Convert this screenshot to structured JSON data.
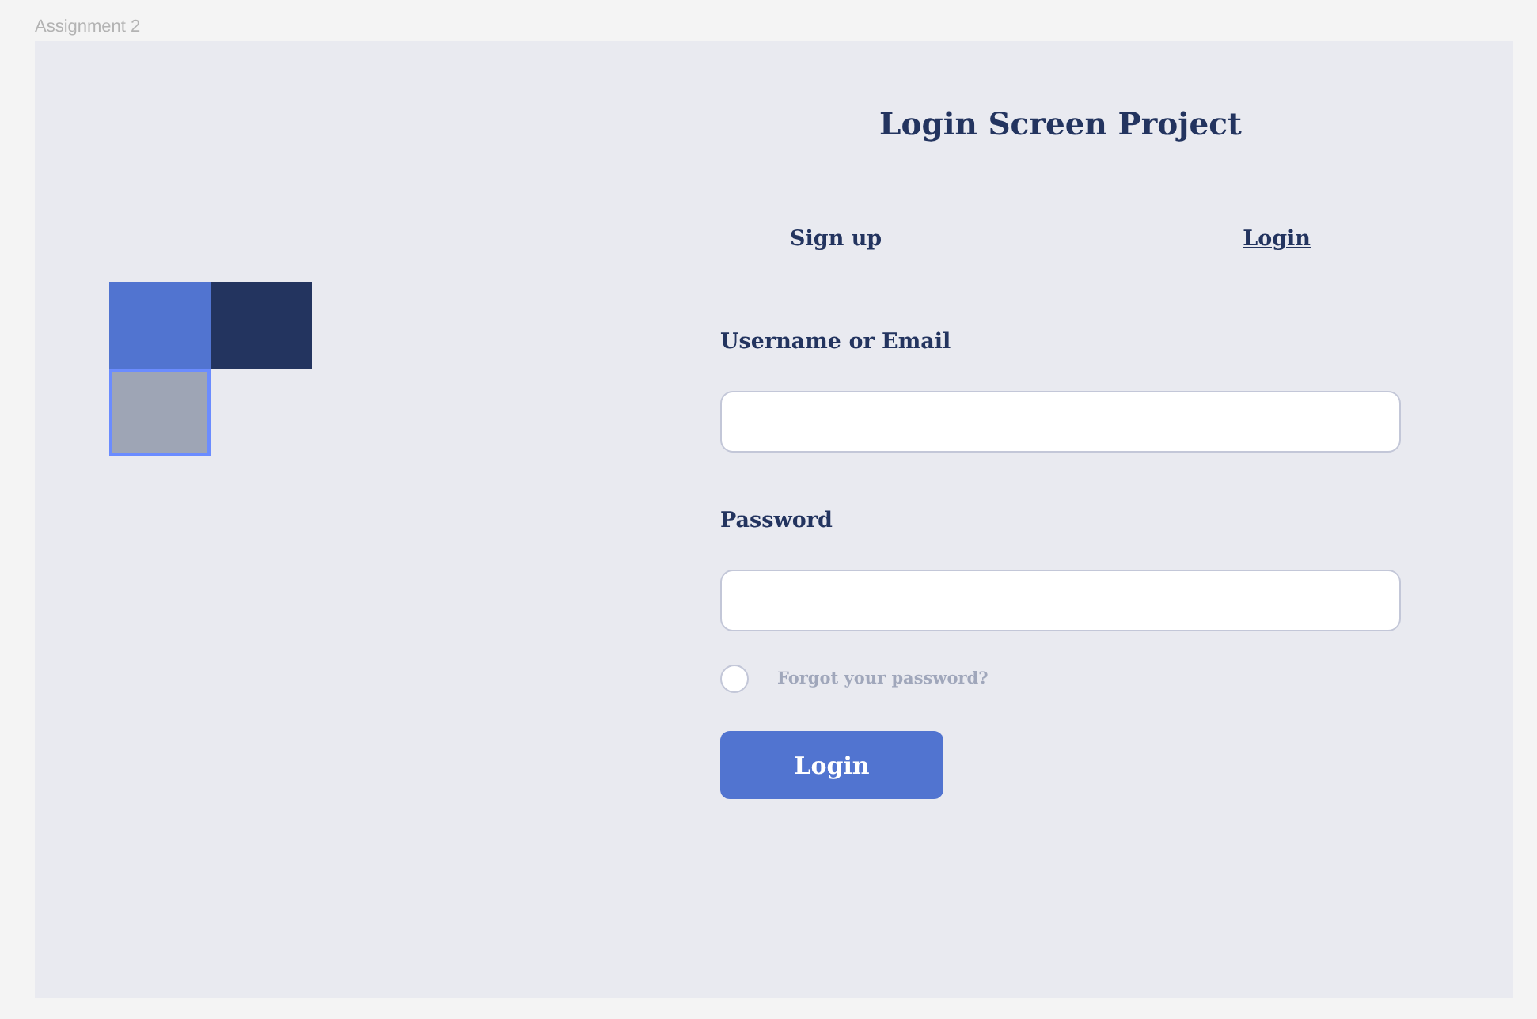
{
  "canvas": {
    "frame_label": "Assignment 2"
  },
  "logo": {
    "tiles": [
      {
        "color": "#5174d0",
        "selected": false
      },
      {
        "color": "#23345f",
        "selected": false
      },
      {
        "color": "#9ea5b5",
        "selected": true
      }
    ]
  },
  "title": "Login Screen Project",
  "tabs": [
    {
      "label": "Sign up",
      "selected": false
    },
    {
      "label": "Login",
      "selected": true
    }
  ],
  "fields": [
    {
      "label": "Username or Email"
    },
    {
      "label": "Password"
    }
  ],
  "remember": {
    "checked": false,
    "link": "Forgot your password?"
  },
  "button": {
    "label": "Login"
  }
}
